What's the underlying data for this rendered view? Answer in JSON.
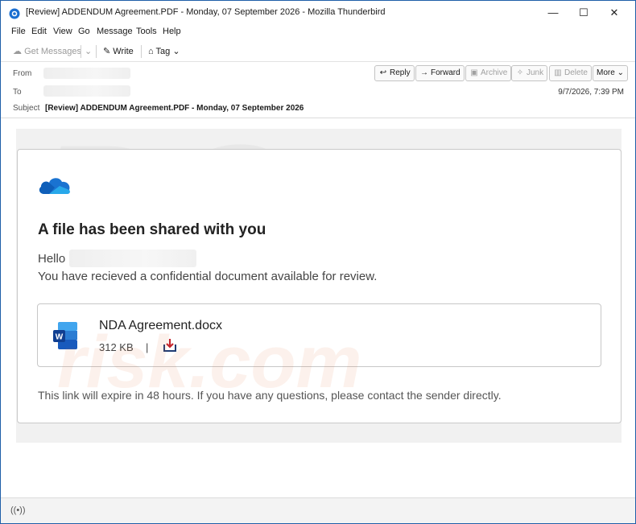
{
  "window": {
    "title": "[Review] ADDENDUM Agreement.PDF - Monday, 07 September 2026 - Mozilla Thunderbird",
    "minimize": "—",
    "maximize": "☐",
    "close": "✕"
  },
  "menu": {
    "file": "File",
    "edit": "Edit",
    "view": "View",
    "go": "Go",
    "message": "Message",
    "tools": "Tools",
    "help": "Help"
  },
  "toolbar": {
    "get_messages": "Get Messages",
    "write": "Write",
    "tag": "Tag"
  },
  "header": {
    "from_label": "From",
    "to_label": "To",
    "subject_label": "Subject",
    "subject": "[Review] ADDENDUM Agreement.PDF - Monday, 07 September 2026",
    "date": "9/7/2026, 7:39 PM",
    "buttons": {
      "reply": "Reply",
      "forward": "Forward",
      "archive": "Archive",
      "junk": "Junk",
      "delete": "Delete",
      "more": "More"
    }
  },
  "email": {
    "headline": "A file has been shared with you",
    "greeting": "Hello",
    "body": "You have recieved a confidential document available for review.",
    "file": {
      "name": "NDA Agreement.docx",
      "size": "312 KB",
      "separator": "|"
    },
    "footer": "This link will expire in 48 hours. If you have any questions, please contact the sender directly."
  },
  "colors": {
    "onedrive_blue": "#1a73d1",
    "word_blue": "#185abd",
    "download_red": "#c4262e"
  },
  "watermark": {
    "top": "PC",
    "bottom": "risk.com"
  }
}
